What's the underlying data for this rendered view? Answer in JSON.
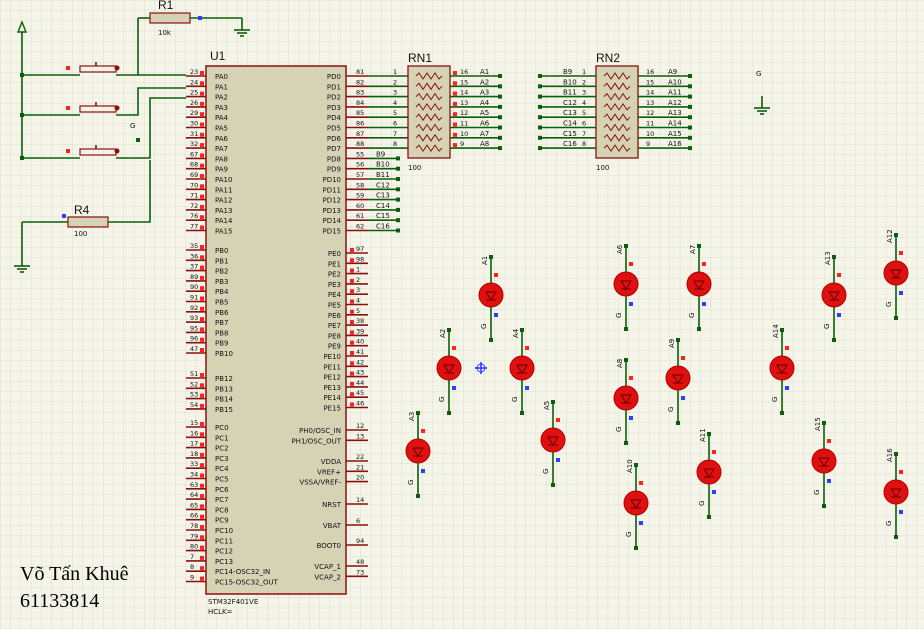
{
  "u1": {
    "ref": "U1",
    "part": "STM32F401VE",
    "hclk": "HCLK=",
    "left_pins": [
      {
        "num": "23",
        "name": "PA0"
      },
      {
        "num": "24",
        "name": "PA1"
      },
      {
        "num": "25",
        "name": "PA2"
      },
      {
        "num": "26",
        "name": "PA3"
      },
      {
        "num": "29",
        "name": "PA4"
      },
      {
        "num": "30",
        "name": "PA5"
      },
      {
        "num": "31",
        "name": "PA6"
      },
      {
        "num": "32",
        "name": "PA7"
      },
      {
        "num": "67",
        "name": "PA8"
      },
      {
        "num": "68",
        "name": "PA9"
      },
      {
        "num": "69",
        "name": "PA10"
      },
      {
        "num": "70",
        "name": "PA11"
      },
      {
        "num": "71",
        "name": "PA12"
      },
      {
        "num": "72",
        "name": "PA13"
      },
      {
        "num": "76",
        "name": "PA14"
      },
      {
        "num": "77",
        "name": "PA15"
      },
      {
        "num": "35",
        "name": "PB0"
      },
      {
        "num": "36",
        "name": "PB1"
      },
      {
        "num": "37",
        "name": "PB2"
      },
      {
        "num": "89",
        "name": "PB3"
      },
      {
        "num": "90",
        "name": "PB4"
      },
      {
        "num": "91",
        "name": "PB5"
      },
      {
        "num": "92",
        "name": "PB6"
      },
      {
        "num": "93",
        "name": "PB7"
      },
      {
        "num": "95",
        "name": "PB8"
      },
      {
        "num": "96",
        "name": "PB9"
      },
      {
        "num": "47",
        "name": "PB10"
      },
      {
        "num": "51",
        "name": "PB12"
      },
      {
        "num": "52",
        "name": "PB13"
      },
      {
        "num": "53",
        "name": "PB14"
      },
      {
        "num": "54",
        "name": "PB15"
      },
      {
        "num": "15",
        "name": "PC0"
      },
      {
        "num": "16",
        "name": "PC1"
      },
      {
        "num": "17",
        "name": "PC2"
      },
      {
        "num": "18",
        "name": "PC3"
      },
      {
        "num": "33",
        "name": "PC4"
      },
      {
        "num": "34",
        "name": "PC5"
      },
      {
        "num": "63",
        "name": "PC6"
      },
      {
        "num": "64",
        "name": "PC7"
      },
      {
        "num": "65",
        "name": "PC8"
      },
      {
        "num": "66",
        "name": "PC9"
      },
      {
        "num": "78",
        "name": "PC10"
      },
      {
        "num": "79",
        "name": "PC11"
      },
      {
        "num": "80",
        "name": "PC12"
      },
      {
        "num": "7",
        "name": "PC13"
      },
      {
        "num": "8",
        "name": "PC14-OSC32_IN"
      },
      {
        "num": "9",
        "name": "PC15-OSC32_OUT"
      }
    ],
    "right_pins": [
      {
        "num": "81",
        "name": "PD0"
      },
      {
        "num": "82",
        "name": "PD1"
      },
      {
        "num": "83",
        "name": "PD2"
      },
      {
        "num": "84",
        "name": "PD3"
      },
      {
        "num": "85",
        "name": "PD4"
      },
      {
        "num": "86",
        "name": "PD5"
      },
      {
        "num": "87",
        "name": "PD6"
      },
      {
        "num": "88",
        "name": "PD7"
      },
      {
        "num": "55",
        "name": "PD8"
      },
      {
        "num": "56",
        "name": "PD9"
      },
      {
        "num": "57",
        "name": "PD10"
      },
      {
        "num": "58",
        "name": "PD11"
      },
      {
        "num": "59",
        "name": "PD12"
      },
      {
        "num": "60",
        "name": "PD13"
      },
      {
        "num": "61",
        "name": "PD14"
      },
      {
        "num": "62",
        "name": "PD15"
      },
      {
        "num": "97",
        "name": "PE0"
      },
      {
        "num": "98",
        "name": "PE1"
      },
      {
        "num": "1",
        "name": "PE2"
      },
      {
        "num": "2",
        "name": "PE3"
      },
      {
        "num": "3",
        "name": "PE4"
      },
      {
        "num": "4",
        "name": "PE5"
      },
      {
        "num": "5",
        "name": "PE6"
      },
      {
        "num": "38",
        "name": "PE7"
      },
      {
        "num": "39",
        "name": "PE8"
      },
      {
        "num": "40",
        "name": "PE9"
      },
      {
        "num": "41",
        "name": "PE10"
      },
      {
        "num": "42",
        "name": "PE11"
      },
      {
        "num": "43",
        "name": "PE12"
      },
      {
        "num": "44",
        "name": "PE13"
      },
      {
        "num": "45",
        "name": "PE14"
      },
      {
        "num": "46",
        "name": "PE15"
      },
      {
        "num": "12",
        "name": "PH0/OSC_IN"
      },
      {
        "num": "13",
        "name": "PH1/OSC_OUT"
      },
      {
        "num": "22",
        "name": "VDDA"
      },
      {
        "num": "21",
        "name": "VREF+"
      },
      {
        "num": "20",
        "name": "VSSA/VREF-"
      },
      {
        "num": "14",
        "name": "NRST"
      },
      {
        "num": "6",
        "name": "VBAT"
      },
      {
        "num": "94",
        "name": "BOOT0"
      },
      {
        "num": "48",
        "name": "VCAP_1"
      },
      {
        "num": "73",
        "name": "VCAP_2"
      }
    ],
    "net_labels": [
      "B9",
      "B10",
      "B11",
      "C12",
      "C13",
      "C14",
      "C15",
      "C16"
    ]
  },
  "r1": {
    "ref": "R1",
    "value": "10k"
  },
  "r4": {
    "ref": "R4",
    "value": "100"
  },
  "rn1": {
    "ref": "RN1",
    "value": "100",
    "left_nums": [
      "1",
      "2",
      "3",
      "4",
      "5",
      "6",
      "7",
      "8"
    ],
    "right_nums": [
      "16",
      "15",
      "14",
      "13",
      "12",
      "11",
      "10",
      "9"
    ],
    "nets": [
      "A1",
      "A2",
      "A3",
      "A4",
      "A5",
      "A6",
      "A7",
      "A8"
    ]
  },
  "rn2": {
    "ref": "RN2",
    "value": "100",
    "left_nets": [
      "B9",
      "B10",
      "B11",
      "C12",
      "C13",
      "C14",
      "C15",
      "C16"
    ],
    "left_nums": [
      "1",
      "2",
      "3",
      "4",
      "5",
      "6",
      "7",
      "8"
    ],
    "right_nums": [
      "16",
      "15",
      "14",
      "13",
      "12",
      "11",
      "10",
      "9"
    ],
    "nets": [
      "A9",
      "A10",
      "A11",
      "A12",
      "A13",
      "A14",
      "A15",
      "A16"
    ]
  },
  "leds": [
    "A1",
    "A2",
    "A3",
    "A4",
    "A5",
    "A6",
    "A7",
    "A8",
    "A9",
    "A10",
    "A11",
    "A12",
    "A13",
    "A14",
    "A15",
    "A16"
  ],
  "ground_label": "G",
  "author": {
    "name": "Võ Tấn Khuê",
    "id": "61133814"
  },
  "colors": {
    "wire": "#0b5e0b",
    "led": "#e01010",
    "body": "#d6d2b4",
    "border": "#8a1010",
    "grid": "#c9c7b4",
    "pin_red": "#ff2020",
    "pin_blue": "#2a40ff"
  }
}
